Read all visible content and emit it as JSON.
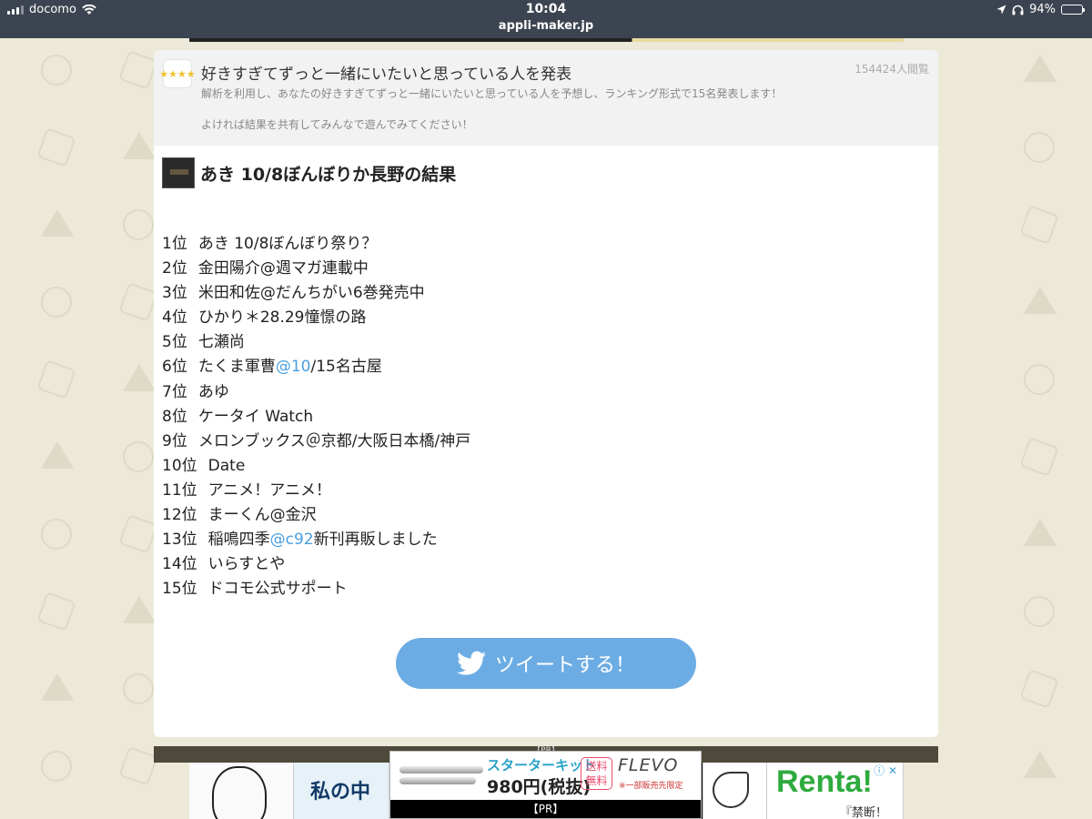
{
  "statusbar": {
    "carrier": "docomo",
    "time": "10:04",
    "url": "appli-maker.jp",
    "battery": "94%",
    "battery_level": 0.94
  },
  "app": {
    "title": "好きすぎてずっと一緒にいたいと思っている人を発表",
    "views": "154424人閲覧",
    "description_1": "解析を利用し、あなたの好きすぎてずっと一緒にいたいと思っている人を予想し、ランキング形式で15名発表します！",
    "description_2": "よければ結果を共有してみんなで遊んでみてください！"
  },
  "result": {
    "title": "あき 10/8ぼんぼりか長野の結果"
  },
  "ranking": [
    {
      "rank": "1位",
      "name": "あき 10/8ぼんぼり祭り？"
    },
    {
      "rank": "2位",
      "name": "金田陽介@週マガ連載中"
    },
    {
      "rank": "3位",
      "name": "米田和佐@だんちがい6巻発売中"
    },
    {
      "rank": "4位",
      "name": "ひかり＊28.29憧憬の路"
    },
    {
      "rank": "5位",
      "name": "七瀬尚"
    },
    {
      "rank": "6位",
      "name_pre": "たくま軍曹",
      "mention": "@10",
      "name_post": "/15名古屋"
    },
    {
      "rank": "7位",
      "name": "あゆ"
    },
    {
      "rank": "8位",
      "name": "ケータイ Watch"
    },
    {
      "rank": "9位",
      "name": "メロンブックス＠京都/大阪日本橋/神戸"
    },
    {
      "rank": "10位",
      "name": "Date"
    },
    {
      "rank": "11位",
      "name": "アニメ！アニメ！"
    },
    {
      "rank": "12位",
      "name": "まーくん@金沢"
    },
    {
      "rank": "13位",
      "name_pre": "稲鳴四季",
      "mention": "@c92",
      "name_post": "新刊再販しました"
    },
    {
      "rank": "14位",
      "name": "いらすとや"
    },
    {
      "rank": "15位",
      "name": "ドコモ公式サポート"
    }
  ],
  "tweet_button": {
    "label": "ツイートする！",
    "color": "#6cace4"
  },
  "ads": {
    "strip_label": "【PR】",
    "blue_text": "私の中",
    "renta_logo": "Renta!",
    "renta_sub": "『禁断！",
    "overlay": {
      "headline": "スターターキット",
      "price": "980円(税抜)",
      "badge": "送料\n無料",
      "brand": "FLEVO",
      "note": "※一部販売先限定",
      "pr": "【PR】"
    }
  },
  "icons": {
    "wifi": "wifi-icon",
    "location": "location-arrow-icon",
    "headphones": "headphones-icon",
    "twitter": "twitter-bird-icon"
  }
}
